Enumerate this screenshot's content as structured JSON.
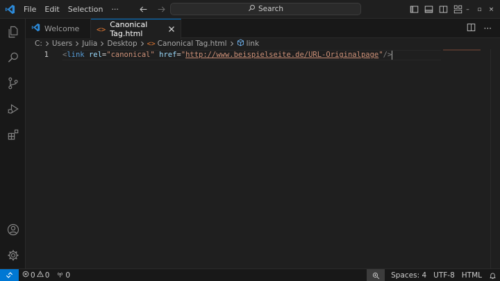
{
  "menu": {
    "file": "File",
    "edit": "Edit",
    "selection": "Selection",
    "more": "···"
  },
  "search": {
    "label": "Search"
  },
  "window_controls": {
    "minimize": "–",
    "maximize": "▫",
    "close": "×"
  },
  "tabs": [
    {
      "label": "Welcome",
      "icon": "vscode-icon",
      "active": false
    },
    {
      "label": "Canonical Tag.html",
      "icon": "html-icon",
      "active": true
    }
  ],
  "breadcrumb": {
    "drive": "C:",
    "items": [
      "Users",
      "Julia",
      "Desktop",
      "Canonical Tag.html",
      "link"
    ]
  },
  "editor": {
    "line_number": "1",
    "code": {
      "open": "<",
      "tag": "link",
      "attr1": "rel",
      "eq1": "=",
      "val1": "\"canonical\"",
      "attr2": "href",
      "eq2": "=",
      "q_open": "\"",
      "url": "http://www.beispielseite.de/URL-Originalpage",
      "q_close": "\"",
      "close": "/>"
    }
  },
  "statusbar": {
    "errors": "0",
    "warnings": "0",
    "ports": "0",
    "spaces": "Spaces: 4",
    "encoding": "UTF-8",
    "language": "HTML"
  },
  "colors": {
    "accent": "#0078d4",
    "bg": "#1f1f1f",
    "sidebar": "#181818"
  }
}
